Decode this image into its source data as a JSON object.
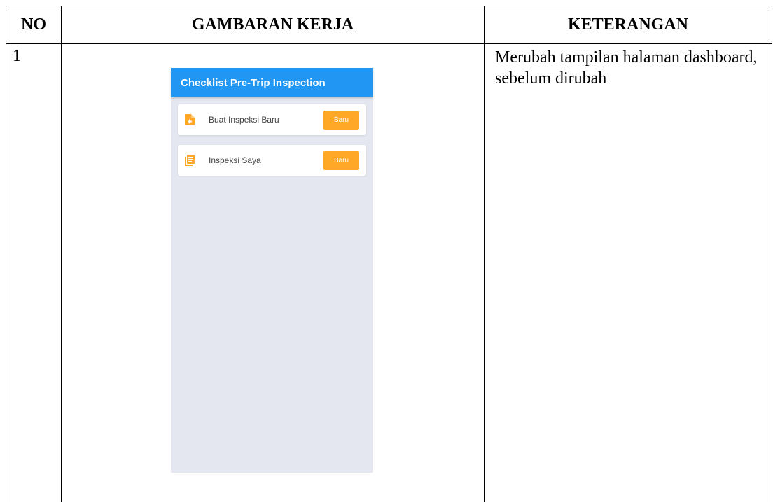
{
  "table": {
    "headers": {
      "no": "NO",
      "gambaran": "GAMBARAN KERJA",
      "keterangan": "KETERANGAN"
    },
    "rows": [
      {
        "no": "1",
        "keterangan": "Merubah tampilan halaman dashboard, sebelum dirubah"
      }
    ]
  },
  "app": {
    "title": "Checklist Pre-Trip Inspection",
    "accent_color": "#2196f3",
    "button_color": "#ffa726",
    "items": [
      {
        "icon": "new-document-icon",
        "label": "Buat Inspeksi Baru",
        "button": "Baru"
      },
      {
        "icon": "list-document-icon",
        "label": "Inspeksi Saya",
        "button": "Baru"
      }
    ]
  }
}
